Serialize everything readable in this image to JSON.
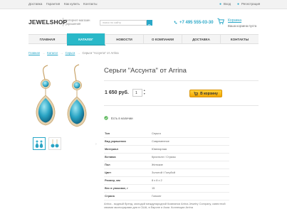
{
  "topbar": {
    "links": [
      "Доставка",
      "Гарантия",
      "Как купить",
      "Контакты"
    ],
    "login": "Вход",
    "register": "Регистрация"
  },
  "header": {
    "logo": "JEWELSHOP",
    "tagline": "интернет-магазин украшения",
    "search_placeholder": "поиск по сайту",
    "phone": "+7 495 555-03-30",
    "cart_link": "Корзина",
    "cart_status": "Ваша корзина пуста"
  },
  "nav": {
    "items": [
      "ГЛАВНАЯ",
      "КАТАЛОГ",
      "НОВОСТИ",
      "О КОМПАНИИ",
      "ДОСТАВКА",
      "КОНТАКТЫ"
    ],
    "active_index": 1
  },
  "breadcrumbs": {
    "items": [
      "Главная",
      "Каталог",
      "Серьги"
    ],
    "current": "Серьги \"Ассунта\" от Arrina"
  },
  "product": {
    "title": "Серьги \"Ассунта\" от Arrina",
    "price": "1 650 руб.",
    "quantity": "1",
    "buy_label": "В корзину",
    "stock": "Есть в наличии",
    "properties": [
      {
        "key": "Тип",
        "value": "Серьги"
      },
      {
        "key": "Вид украшения",
        "value": "Современное"
      },
      {
        "key": "Материал",
        "value": "Ювелирная"
      },
      {
        "key": "Вставка",
        "value": "Кристалл / Стразы"
      },
      {
        "key": "Пол",
        "value": "Женские"
      },
      {
        "key": "Цвет",
        "value": "Золотой / Голубой"
      },
      {
        "key": "Размер, мм",
        "value": "8 x 8 x 2"
      },
      {
        "key": "Вес в упаковке, г",
        "value": "15"
      },
      {
        "key": "Страна",
        "value": "Гонконг"
      }
    ],
    "description": "Arrina - модный бренд, молодой международной Компании Arrina Jewelry Company, известной своими аксессуарами для в США, в Европе и Азии. Коллекции Arrina",
    "thumbnail_count": 2
  },
  "colors": {
    "accent": "#2aa8c8",
    "nav_active": "#29b8c8",
    "buy_button": "#f7b500",
    "in_stock": "#5cb85c"
  }
}
